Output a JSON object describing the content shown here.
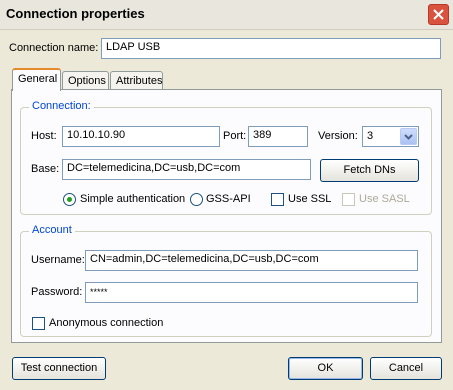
{
  "window": {
    "title": "Connection properties"
  },
  "connection_name": {
    "label": "Connection name:",
    "value": "LDAP USB"
  },
  "tabs": [
    {
      "label": "General",
      "active": true
    },
    {
      "label": "Options",
      "active": false
    },
    {
      "label": "Attributes",
      "active": false
    }
  ],
  "connection_group": {
    "title": "Connection:",
    "host_label": "Host:",
    "host_value": "10.10.10.90",
    "port_label": "Port:",
    "port_value": "389",
    "version_label": "Version:",
    "version_value": "3",
    "base_label": "Base:",
    "base_value": "DC=telemedicina,DC=usb,DC=com",
    "fetch_button": "Fetch DNs",
    "auth_simple": "Simple authentication",
    "auth_gss": "GSS-API",
    "use_ssl": "Use SSL",
    "use_sasl": "Use SASL"
  },
  "account_group": {
    "title": "Account",
    "username_label": "Username:",
    "username_value": "CN=admin,DC=telemedicina,DC=usb,DC=com",
    "password_label": "Password:",
    "password_value": "*****",
    "anonymous_label": "Anonymous connection"
  },
  "buttons": {
    "test": "Test connection",
    "ok": "OK",
    "cancel": "Cancel"
  },
  "colors": {
    "group_title": "#0046d5",
    "close_button": "#d9533f",
    "tab_highlight": "#e68b2c"
  }
}
